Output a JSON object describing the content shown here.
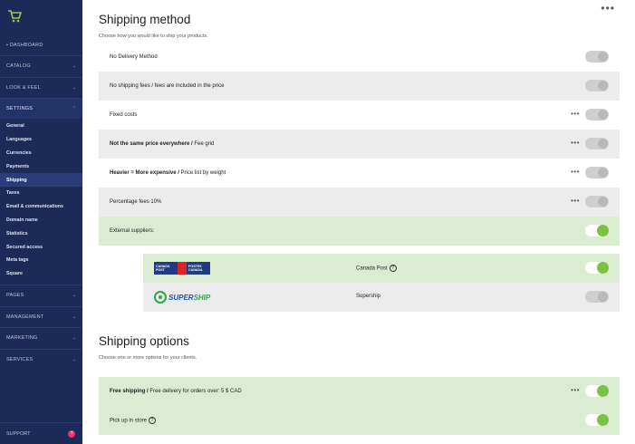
{
  "sidebar": {
    "logo_icon": "cart-icon",
    "dashboard": "• DASHBOARD",
    "catalog": "CATALOG",
    "look_feel": "LOOK & FEEL",
    "settings": "SETTINGS",
    "settings_items": [
      "General",
      "Languages",
      "Currencies",
      "Payments",
      "Shipping",
      "Taxes",
      "Email & communications",
      "Domain name",
      "Statistics",
      "Secured access",
      "Meta tags",
      "Square"
    ],
    "pages": "PAGES",
    "management": "MANAGEMENT",
    "marketing": "MARKETING",
    "services": "SERVICES",
    "support": "SUPPORT",
    "support_badge": "?"
  },
  "shipping_method": {
    "title": "Shipping method",
    "subtitle": "Choose how you would like to ship your products.",
    "no_delivery": "No Delivery Method",
    "included": "No shipping fees / fees are included in the price",
    "fixed": "Fixed costs",
    "not_same_bold": "Not the same price everywhere /",
    "not_same_rest": " Fee grid",
    "heavier_bold": "Heavier = More expensive /",
    "heavier_rest": " Price list by weight",
    "percentage": "Percentage fees 10%",
    "external": "External suppliers:",
    "canada_post": "Canada Post",
    "canada_post_logo": {
      "l1": "CANADA",
      "l2": "POST",
      "r1": "POSTES",
      "r2": "CANADA"
    },
    "supership": "Supership",
    "supership_logo": {
      "a": "SUPER",
      "b": "SHIP"
    }
  },
  "shipping_options": {
    "title": "Shipping options",
    "subtitle": "Choose one or more options for your clients.",
    "free_bold": "Free shipping /",
    "free_rest": " Free delivery for orders over: 5 $ CAD",
    "pickup": "Pick up in store"
  },
  "help_glyph": "?",
  "dots_glyph": "•••",
  "colors": {
    "sidebar": "#1b2a57",
    "accent_green": "#7bc142",
    "green_row": "#dcecd2",
    "grey_row": "#ececec"
  }
}
